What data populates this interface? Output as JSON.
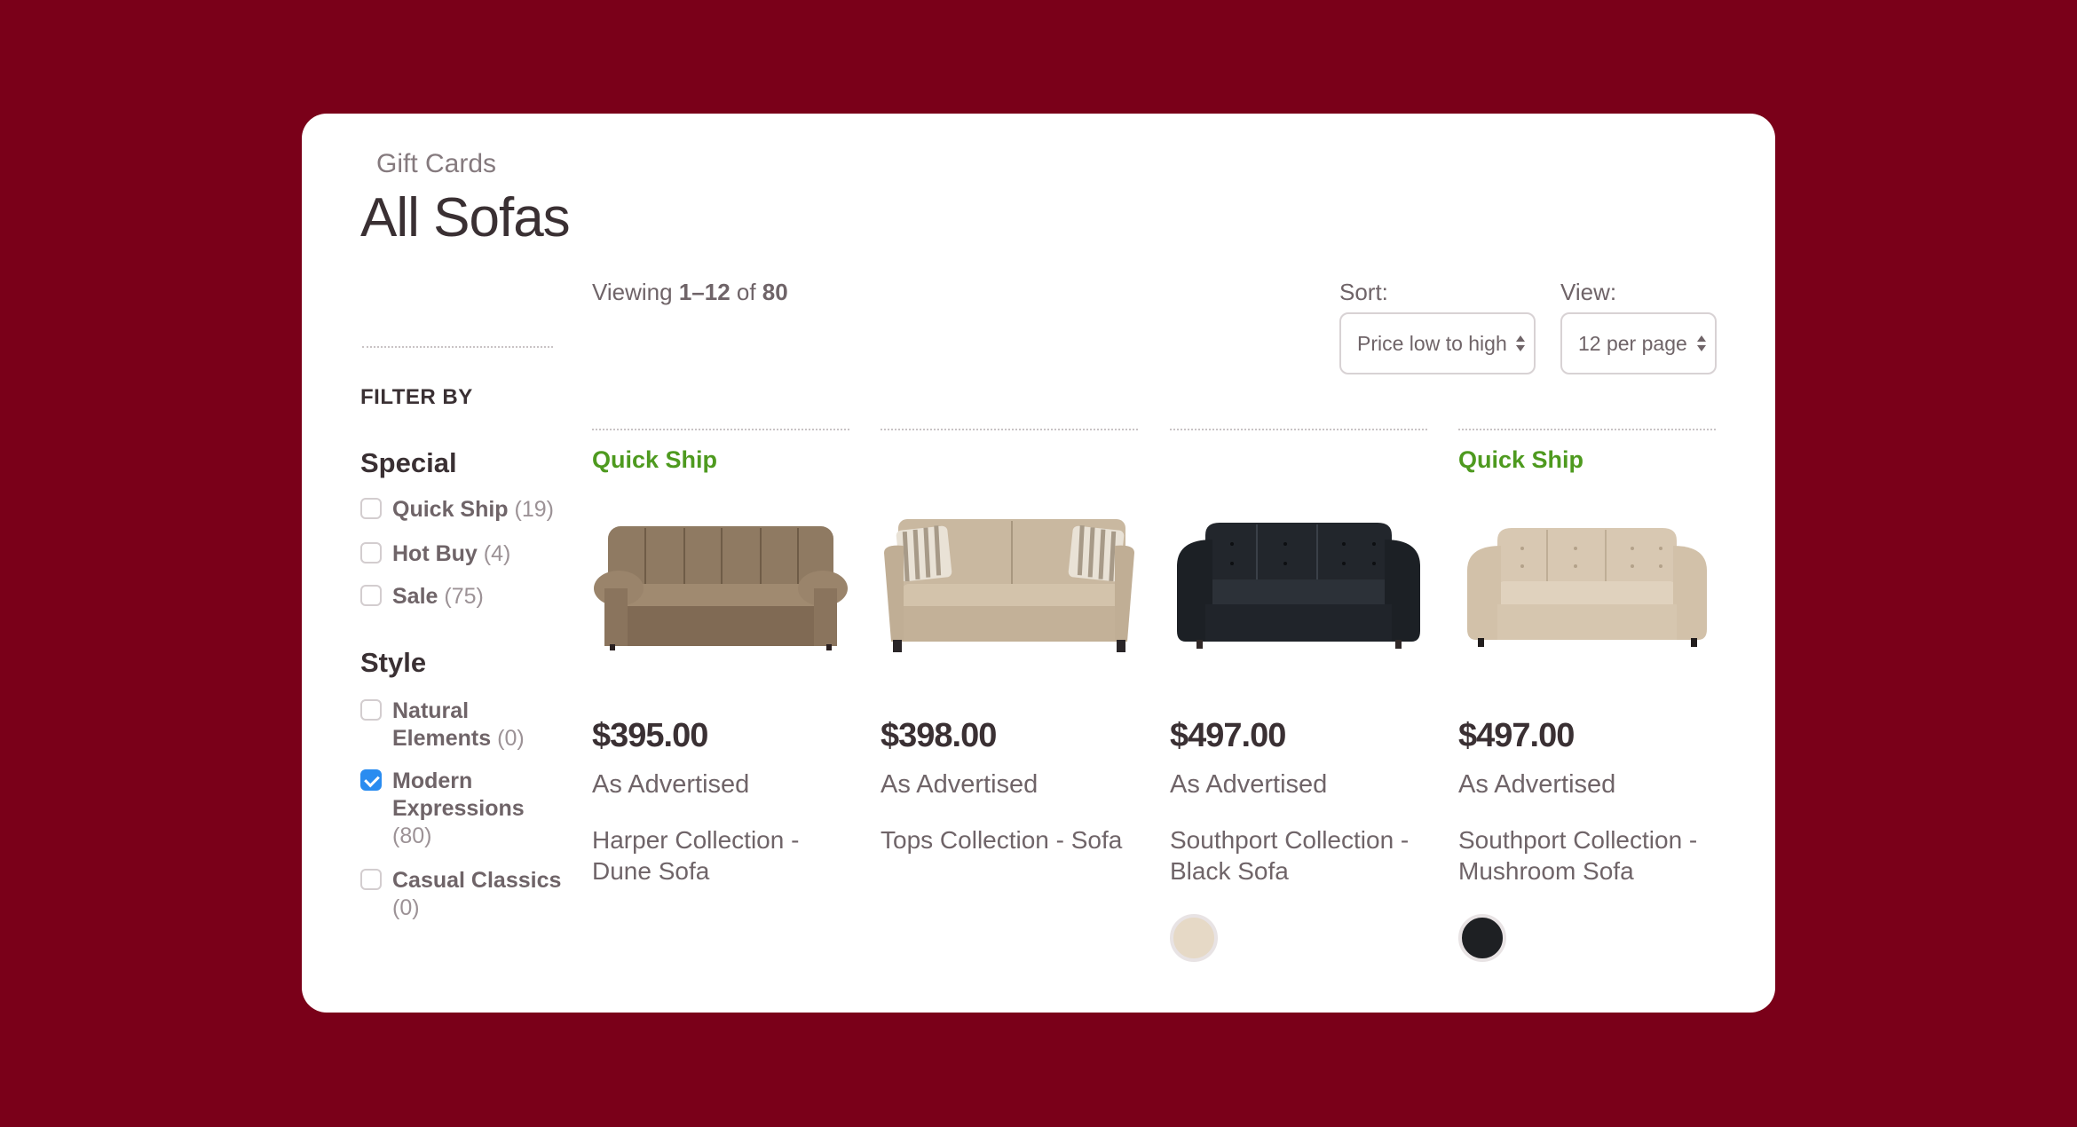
{
  "breadcrumb": "Gift Cards",
  "page_title": "All Sofas",
  "results": {
    "prefix": "Viewing ",
    "range": "1–12",
    "of": " of ",
    "total": "80"
  },
  "controls": {
    "sort_label": "Sort:",
    "sort_value": "Price low to high",
    "view_label": "View:",
    "view_value": "12 per page"
  },
  "filters": {
    "heading": "FILTER BY",
    "groups": [
      {
        "title": "Special",
        "items": [
          {
            "label": "Quick Ship",
            "count": "(19)",
            "checked": false
          },
          {
            "label": "Hot Buy",
            "count": "(4)",
            "checked": false
          },
          {
            "label": "Sale",
            "count": "(75)",
            "checked": false
          }
        ]
      },
      {
        "title": "Style",
        "items": [
          {
            "label": "Natural Elements",
            "count": "(0)",
            "checked": false
          },
          {
            "label": "Modern Expressions",
            "count": "(80)",
            "checked": true
          },
          {
            "label": "Casual Classics",
            "count": "(0)",
            "checked": false
          }
        ]
      }
    ]
  },
  "products": [
    {
      "badge": "Quick Ship",
      "price": "$395.00",
      "note": "As Advertised",
      "name": "Harper Collection - Dune Sofa",
      "image": "sofa-brown-plush",
      "swatches": []
    },
    {
      "badge": "",
      "price": "$398.00",
      "note": "As Advertised",
      "name": "Tops Collection - Sofa",
      "image": "sofa-beige-pillows",
      "swatches": []
    },
    {
      "badge": "",
      "price": "$497.00",
      "note": "As Advertised",
      "name": "Southport Collection - Black Sofa",
      "image": "sofa-black-leather",
      "swatches": [
        "#e6d9c6"
      ]
    },
    {
      "badge": "Quick Ship",
      "price": "$497.00",
      "note": "As Advertised",
      "name": "Southport Collection - Mushroom Sofa",
      "image": "sofa-mushroom-leather",
      "swatches": [
        "#1e2023"
      ]
    }
  ],
  "colors": {
    "background": "#7a0019",
    "quick_ship": "#4e9a1f",
    "checkbox_checked": "#2a8cf0"
  }
}
